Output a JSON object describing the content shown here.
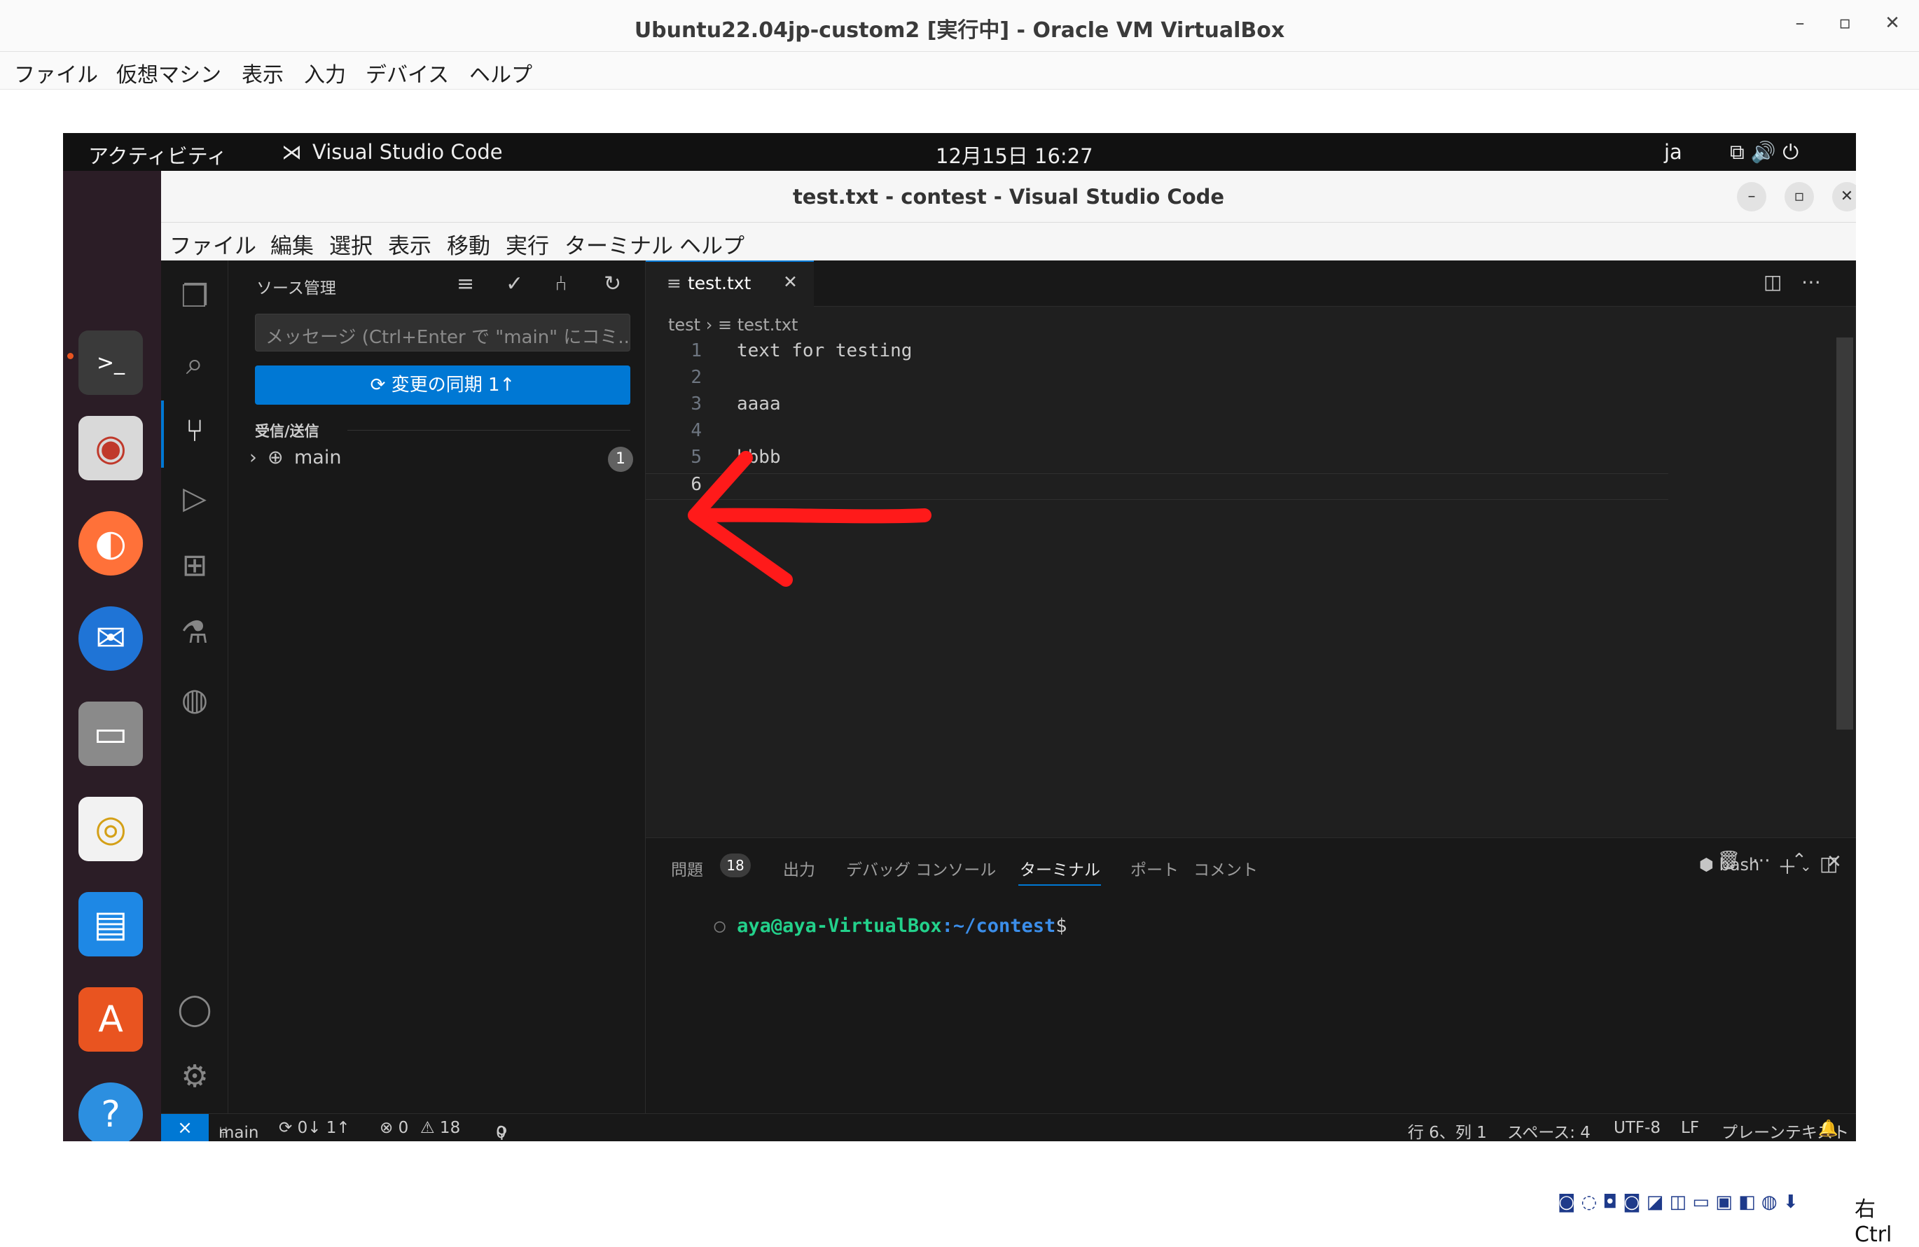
{
  "host": {
    "window_title": "Ubuntu22.04jp-custom2 [実行中] - Oracle VM VirtualBox",
    "menu": [
      "ファイル",
      "仮想マシン",
      "表示",
      "入力",
      "デバイス",
      "ヘルプ"
    ],
    "controls": {
      "minimize": "–",
      "restore": "▫",
      "close": "✕"
    },
    "host_key": "右 Ctrl",
    "tray_icons": "◙ ◌ ◘ ◙ ◪ ◫ ▭ ▣ ◧ ◍ ⬇"
  },
  "gnome": {
    "activities": "アクティビティ",
    "app_name": "Visual Studio Code",
    "clock": "12月15日  16:27",
    "lang": "ja",
    "tray": "⧉  🔊  ⏻"
  },
  "vscode": {
    "title": "test.txt - contest - Visual Studio Code",
    "menu": [
      "ファイル",
      "編集",
      "選択",
      "表示",
      "移動",
      "実行",
      "ターミナル",
      "ヘルプ"
    ],
    "sidebar": {
      "header": "ソース管理",
      "commit_placeholder": "メッセージ (Ctrl+Enter で \"main\" にコミ...",
      "sync_button": "⟳ 変更の同期 1↑",
      "section_label": "受信/送信",
      "branch": "main",
      "branch_badge": "1"
    },
    "editor": {
      "tab": "test.txt",
      "breadcrumb_folder": "test",
      "breadcrumb_file": "test.txt",
      "lines": [
        {
          "n": "1",
          "text": "text for testing"
        },
        {
          "n": "2",
          "text": ""
        },
        {
          "n": "3",
          "text": "aaaa"
        },
        {
          "n": "4",
          "text": ""
        },
        {
          "n": "5",
          "text": "bbbb"
        },
        {
          "n": "6",
          "text": ""
        }
      ]
    },
    "panel": {
      "tabs": [
        "問題",
        "出力",
        "デバッグ コンソール",
        "ターミナル",
        "ポート",
        "コメント"
      ],
      "problems_count": "18",
      "active_tab": "ターミナル",
      "shell": "bash",
      "prompt_user": "aya@aya-VirtualBox",
      "prompt_path": ":~/contest",
      "prompt_end": "$"
    },
    "status": {
      "branch": "main",
      "sync": "⟳ 0↓ 1↑",
      "errors": "⊗ 0",
      "warnings": "⚠ 18",
      "ports": "0",
      "position": "行 6、列 1",
      "spaces": "スペース: 4",
      "encoding": "UTF-8",
      "eol": "LF",
      "language": "プレーンテキスト"
    }
  }
}
